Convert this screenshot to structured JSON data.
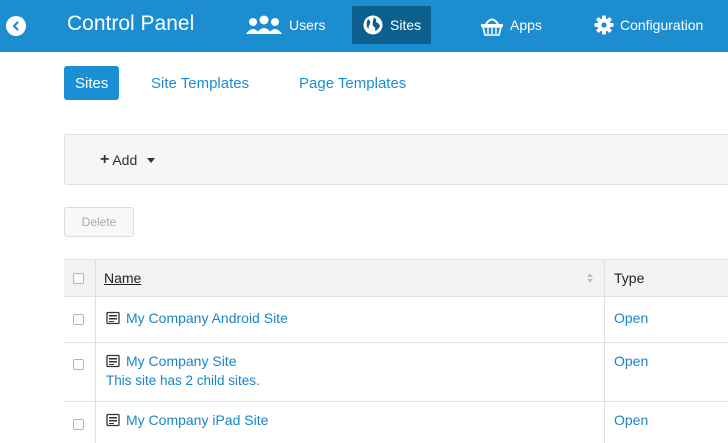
{
  "topbar": {
    "title": "Control Panel",
    "nav": [
      {
        "label": "Users",
        "icon": "users-icon"
      },
      {
        "label": "Sites",
        "icon": "globe-icon",
        "active": true
      },
      {
        "label": "Apps",
        "icon": "basket-icon"
      },
      {
        "label": "Configuration",
        "icon": "gear-icon"
      }
    ],
    "colors": {
      "bar": "#1c8ed0",
      "active": "#0d5f8e"
    }
  },
  "subtabs": [
    {
      "label": "Sites",
      "active": true
    },
    {
      "label": "Site Templates"
    },
    {
      "label": "Page Templates"
    }
  ],
  "toolbar": {
    "add_label": "Add"
  },
  "actions": {
    "delete_label": "Delete"
  },
  "table": {
    "columns": {
      "name": "Name",
      "type": "Type"
    },
    "rows": [
      {
        "name": "My Company Android Site",
        "note": "",
        "type": "Open"
      },
      {
        "name": "My Company Site",
        "note": "This site has 2 child sites.",
        "type": "Open"
      },
      {
        "name": "My Company iPad Site",
        "note": "",
        "type": "Open"
      }
    ]
  },
  "link_color": "#1a84c8"
}
